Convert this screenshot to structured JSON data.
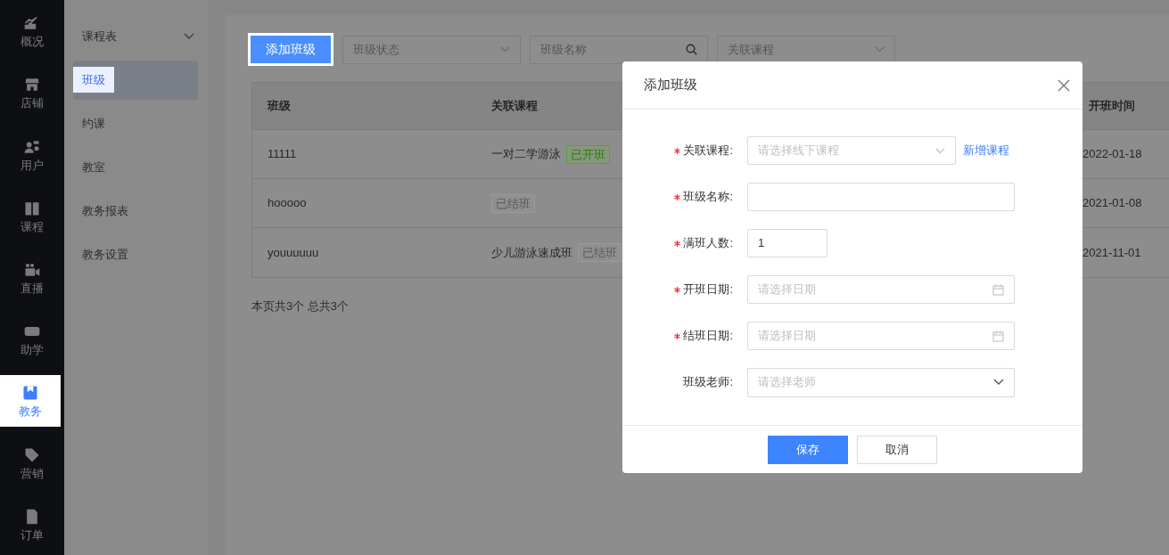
{
  "nav": {
    "items": [
      {
        "label": "概况",
        "selected": false
      },
      {
        "label": "店铺",
        "selected": false
      },
      {
        "label": "用户",
        "selected": false
      },
      {
        "label": "课程",
        "selected": false
      },
      {
        "label": "直播",
        "selected": false
      },
      {
        "label": "助学",
        "selected": false
      },
      {
        "label": "教务",
        "selected": true
      },
      {
        "label": "营销",
        "selected": false
      },
      {
        "label": "订单",
        "selected": false
      }
    ]
  },
  "subnav": {
    "items": [
      {
        "kind": "group",
        "label": "课程表",
        "selected": false
      },
      {
        "kind": "link",
        "label": "班级",
        "selected": true
      },
      {
        "kind": "link",
        "label": "约课",
        "selected": false
      },
      {
        "kind": "link",
        "label": "教室",
        "selected": false
      },
      {
        "kind": "link",
        "label": "教务报表",
        "selected": false
      },
      {
        "kind": "link",
        "label": "教务设置",
        "selected": false
      }
    ]
  },
  "toolbar": {
    "add_button": "添加班级",
    "filters": [
      {
        "kind": "select",
        "placeholder": "班级状态"
      },
      {
        "kind": "search",
        "placeholder": "班级名称"
      },
      {
        "kind": "select",
        "placeholder": "关联课程"
      }
    ]
  },
  "table": {
    "columns": [
      "班级",
      "关联课程",
      "开班时间"
    ],
    "rows": [
      {
        "name": "11111",
        "course": {
          "title": "一对二学游泳",
          "status": {
            "kind": "open",
            "label": "已开班"
          }
        },
        "start": "2022-01-18"
      },
      {
        "name": "hooooo",
        "course": {
          "status": {
            "kind": "closed",
            "label": "已结班"
          }
        },
        "start": "2021-01-08"
      },
      {
        "name": "youuuuuu",
        "course": {
          "title": "少儿游泳速成班",
          "status": {
            "kind": "closed",
            "label": "已结班"
          }
        },
        "start": "2021-11-01"
      }
    ]
  },
  "summary": "本页共3个 总共3个",
  "dialog": {
    "title": "添加班级",
    "fields": [
      {
        "kind": "select",
        "label": "关联课程:",
        "required": true,
        "placeholder": "请选择线下课程",
        "link": "新增课程"
      },
      {
        "kind": "text",
        "label": "班级名称:",
        "required": true
      },
      {
        "kind": "number",
        "label": "满班人数:",
        "required": true,
        "value": "1"
      },
      {
        "kind": "date",
        "label": "开班日期:",
        "required": true,
        "placeholder": "请选择日期"
      },
      {
        "kind": "date",
        "label": "结班日期:",
        "required": true,
        "placeholder": "请选择日期"
      },
      {
        "kind": "select",
        "label": "班级老师:",
        "required": false,
        "placeholder": "请选择老师"
      }
    ],
    "buttons": [
      {
        "kind": "primary",
        "label": "保存"
      },
      {
        "kind": "default",
        "label": "取消"
      }
    ]
  }
}
